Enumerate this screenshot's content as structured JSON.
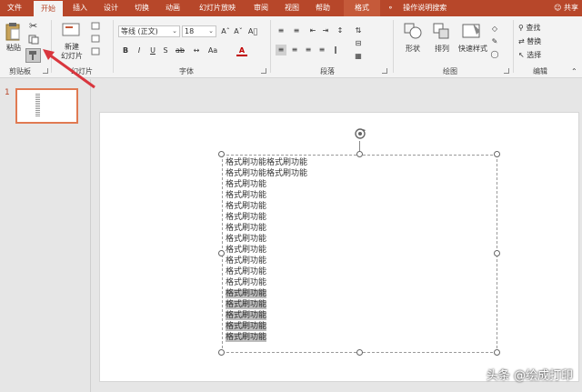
{
  "tabs": [
    {
      "label": "文件"
    },
    {
      "label": "开始"
    },
    {
      "label": "插入"
    },
    {
      "label": "设计"
    },
    {
      "label": "切换"
    },
    {
      "label": "动画"
    },
    {
      "label": "幻灯片放映"
    },
    {
      "label": "审阅"
    },
    {
      "label": "视图"
    },
    {
      "label": "帮助"
    },
    {
      "label": "格式"
    }
  ],
  "tell_me": "操作说明搜索",
  "share": "共享",
  "ribbon": {
    "clipboard": {
      "paste": "粘贴",
      "label": "剪贴板"
    },
    "slides": {
      "new_slide": "新建",
      "new_slide2": "幻灯片",
      "label": "幻灯片"
    },
    "font": {
      "name": "等线 (正文)",
      "size": "18",
      "label": "字体",
      "bold": "B",
      "italic": "I",
      "underline": "U",
      "strike": "S",
      "color_a": "A"
    },
    "paragraph": {
      "label": "段落"
    },
    "drawing": {
      "shapes": "形状",
      "arrange": "排列",
      "quick_styles": "快速样式",
      "label": "绘图"
    },
    "editing": {
      "find": "查找",
      "replace": "替换",
      "select": "选择",
      "label": "编辑"
    }
  },
  "slide_number": "1",
  "text_lines": [
    "格式刷功能格式刷功能",
    "格式刷功能格式刷功能",
    "格式刷功能",
    "格式刷功能",
    "格式刷功能",
    "格式刷功能",
    "格式刷功能",
    "格式刷功能",
    "格式刷功能",
    "格式刷功能",
    "格式刷功能",
    "格式刷功能",
    "格式刷功能",
    "格式刷功能",
    "格式刷功能",
    "格式刷功能",
    "格式刷功能"
  ],
  "watermark": "头条 @绘成打印",
  "colors": {
    "accent": "#b7472a",
    "annotation": "#d9363e"
  }
}
